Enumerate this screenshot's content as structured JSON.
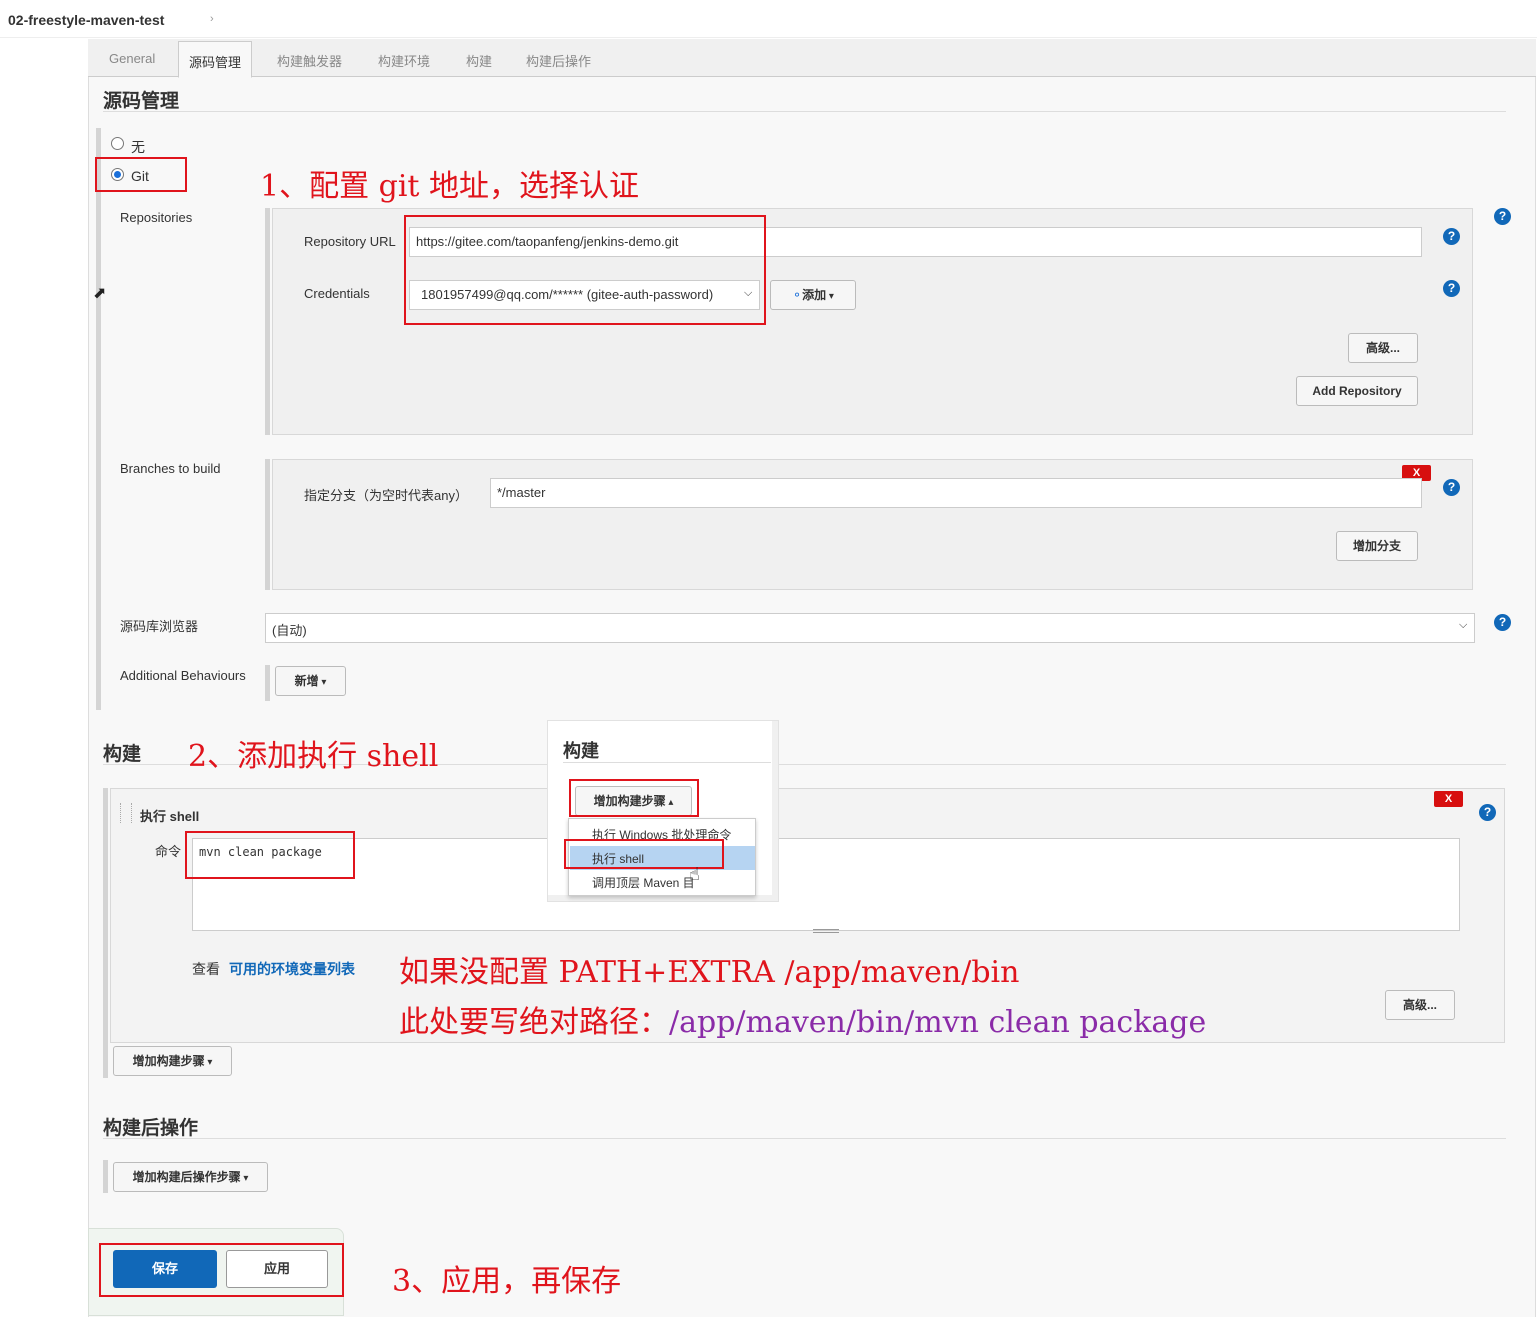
{
  "breadcrumb": {
    "job_name": "02-freestyle-maven-test",
    "chevron": "›"
  },
  "tabs": [
    {
      "label": "General"
    },
    {
      "label": "源码管理"
    },
    {
      "label": "构建触发器"
    },
    {
      "label": "构建环境"
    },
    {
      "label": "构建"
    },
    {
      "label": "构建后操作"
    }
  ],
  "scm": {
    "title": "源码管理",
    "option_none": "无",
    "option_git": "Git",
    "repositories_label": "Repositories",
    "repo_url_label": "Repository URL",
    "repo_url_value": "https://gitee.com/taopanfeng/jenkins-demo.git",
    "credentials_label": "Credentials",
    "credentials_value": "1801957499@qq.com/****** (gitee-auth-password)",
    "add_label": "添加",
    "advanced_label": "高级...",
    "add_repository_label": "Add Repository",
    "branches_label": "Branches to build",
    "branch_specifier_label": "指定分支（为空时代表any）",
    "branch_value": "*/master",
    "add_branch_label": "增加分支",
    "browser_label": "源码库浏览器",
    "browser_value": "(自动)",
    "behaviours_label": "Additional Behaviours",
    "behaviours_button": "新增",
    "remove_label": "X",
    "help_label": "?"
  },
  "build": {
    "title": "构建",
    "step_title": "执行 shell",
    "command_label": "命令",
    "command_value": "mvn clean package",
    "env_prefix": "查看",
    "env_link": "可用的环境变量列表",
    "advanced_label": "高级...",
    "add_step_label": "增加构建步骤"
  },
  "popup": {
    "title": "构建",
    "add_step_label": "增加构建步骤",
    "items": [
      {
        "label": "执行 Windows 批处理命令"
      },
      {
        "label": "执行 shell"
      },
      {
        "label": "调用顶层 Maven 目"
      }
    ]
  },
  "post_build": {
    "title": "构建后操作",
    "add_step_label": "增加构建后操作步骤"
  },
  "actions": {
    "save_label": "保存",
    "apply_label": "应用"
  },
  "annotations": {
    "step1": "1、配置 git 地址，选择认证",
    "step2": "2、添加执行 shell",
    "note_line1": "如果没配置 PATH+EXTRA /app/maven/bin",
    "note_line2_prefix": "此处要写绝对路径：",
    "note_line2_path": "/app/maven/bin/mvn clean package",
    "step3": "3、应用，再保存"
  },
  "colors": {
    "annotation_red": "#e0141c",
    "annotation_purple": "#8a2ba8",
    "primary_button": "#1168b8",
    "help_icon": "#1168b8",
    "remove_button": "#d70f0f",
    "link": "#1168b8"
  }
}
